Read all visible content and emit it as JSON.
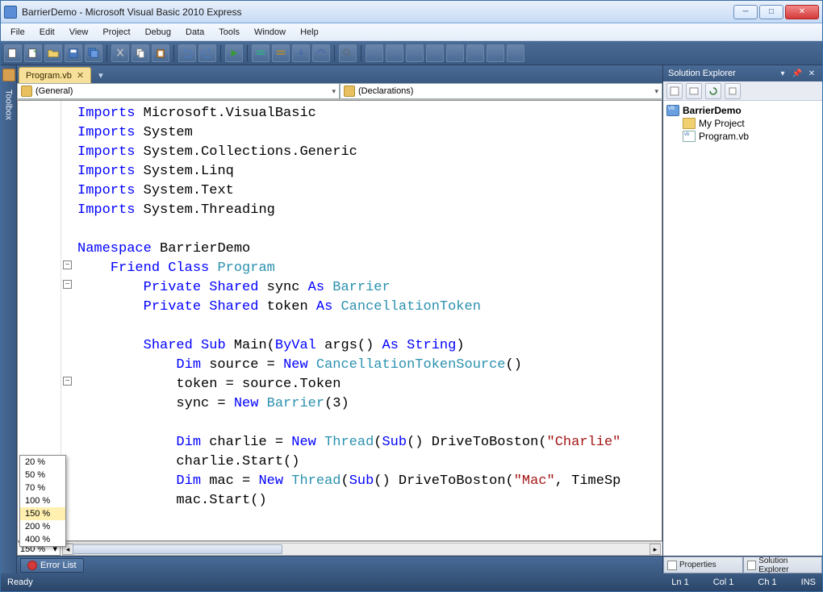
{
  "window": {
    "title": "BarrierDemo - Microsoft Visual Basic 2010 Express"
  },
  "menus": [
    "File",
    "Edit",
    "View",
    "Project",
    "Debug",
    "Data",
    "Tools",
    "Window",
    "Help"
  ],
  "document": {
    "tab_label": "Program.vb",
    "scope_dropdown": "(General)",
    "member_dropdown": "(Declarations)"
  },
  "code": {
    "imports": [
      "Microsoft.VisualBasic",
      "System",
      "System.Collections.Generic",
      "System.Linq",
      "System.Text",
      "System.Threading"
    ],
    "namespace": "BarrierDemo",
    "class_modifier": "Friend Class",
    "class_name": "Program",
    "field1_pre": "Private Shared",
    "field1_name": "sync",
    "field1_as": "As",
    "field1_type": "Barrier",
    "field2_pre": "Private Shared",
    "field2_name": "token",
    "field2_as": "As",
    "field2_type": "CancellationToken",
    "main_sig_pre": "Shared Sub",
    "main_name": "Main",
    "main_paren": "(",
    "main_byval": "ByVal",
    "main_args": " args()",
    "main_as": "As",
    "main_argtype": "String",
    "main_close": ")",
    "l1_dim": "Dim",
    "l1_rest": " source = ",
    "l1_new": "New",
    "l1_type": "CancellationTokenSource",
    "l1_tail": "()",
    "l2": "token = source.Token",
    "l3_pre": "sync = ",
    "l3_new": "New",
    "l3_type": "Barrier",
    "l3_tail": "(3)",
    "l4_dim": "Dim",
    "l4_rest": " charlie = ",
    "l4_new": "New",
    "l4_type": "Thread",
    "l4_sub": "Sub",
    "l4_tail": "() DriveToBoston(",
    "l4_str": "\"Charlie\"",
    "l5": "charlie.Start()",
    "l6_dim": "Dim",
    "l6_rest": " mac = ",
    "l6_new": "New",
    "l6_type": "Thread",
    "l6_sub": "Sub",
    "l6_tail": "() DriveToBoston(",
    "l6_str": "\"Mac\"",
    "l6_after": ", TimeSp",
    "l7": "mac.Start()"
  },
  "zoom": {
    "options": [
      "20 %",
      "50 %",
      "70 %",
      "100 %",
      "150 %",
      "200 %",
      "400 %"
    ],
    "current": "150 %",
    "selected_index": 4
  },
  "error_list": {
    "label": "Error List"
  },
  "toolbox": {
    "label": "Toolbox"
  },
  "solution": {
    "title": "Solution Explorer",
    "project": "BarrierDemo",
    "items": [
      "My Project",
      "Program.vb"
    ]
  },
  "panel_tabs": {
    "properties": "Properties",
    "solution": "Solution Explorer"
  },
  "status": {
    "ready": "Ready",
    "ln": "Ln 1",
    "col": "Col 1",
    "ch": "Ch 1",
    "ins": "INS"
  }
}
